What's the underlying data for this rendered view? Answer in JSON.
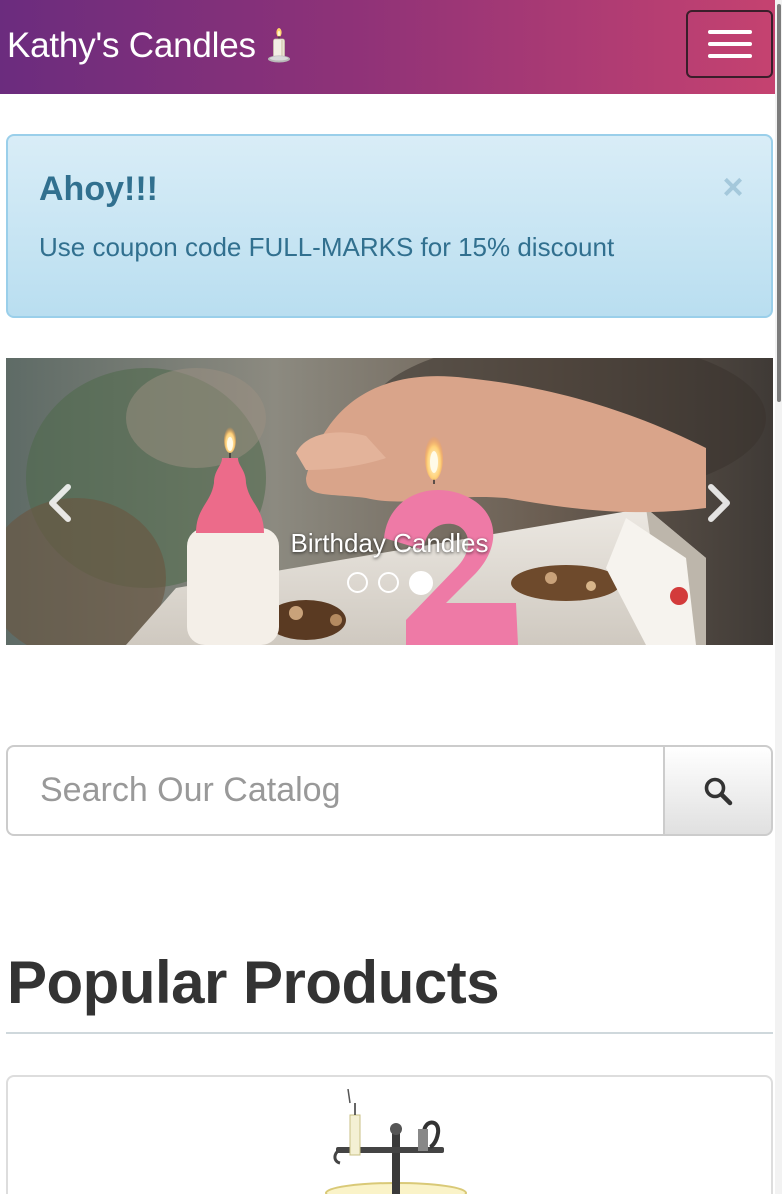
{
  "navbar": {
    "brand": "Kathy's Candles",
    "brand_icon": "candle-icon",
    "menu_icon": "hamburger-icon",
    "gradient": [
      "#6b2c7e",
      "#c54270"
    ]
  },
  "alert": {
    "title": "Ahoy!!!",
    "message": "Use coupon code FULL-MARKS for 15% discount",
    "close_label": "×",
    "background": "#d9edf7",
    "text_color": "#31708f"
  },
  "carousel": {
    "caption": "Birthday Candles",
    "slide_count": 3,
    "active_index": 2,
    "prev_icon": "chevron-left-icon",
    "next_icon": "chevron-right-icon"
  },
  "search": {
    "placeholder": "Search Our Catalog",
    "value": "",
    "button_icon": "search-icon"
  },
  "products": {
    "heading": "Popular Products"
  }
}
